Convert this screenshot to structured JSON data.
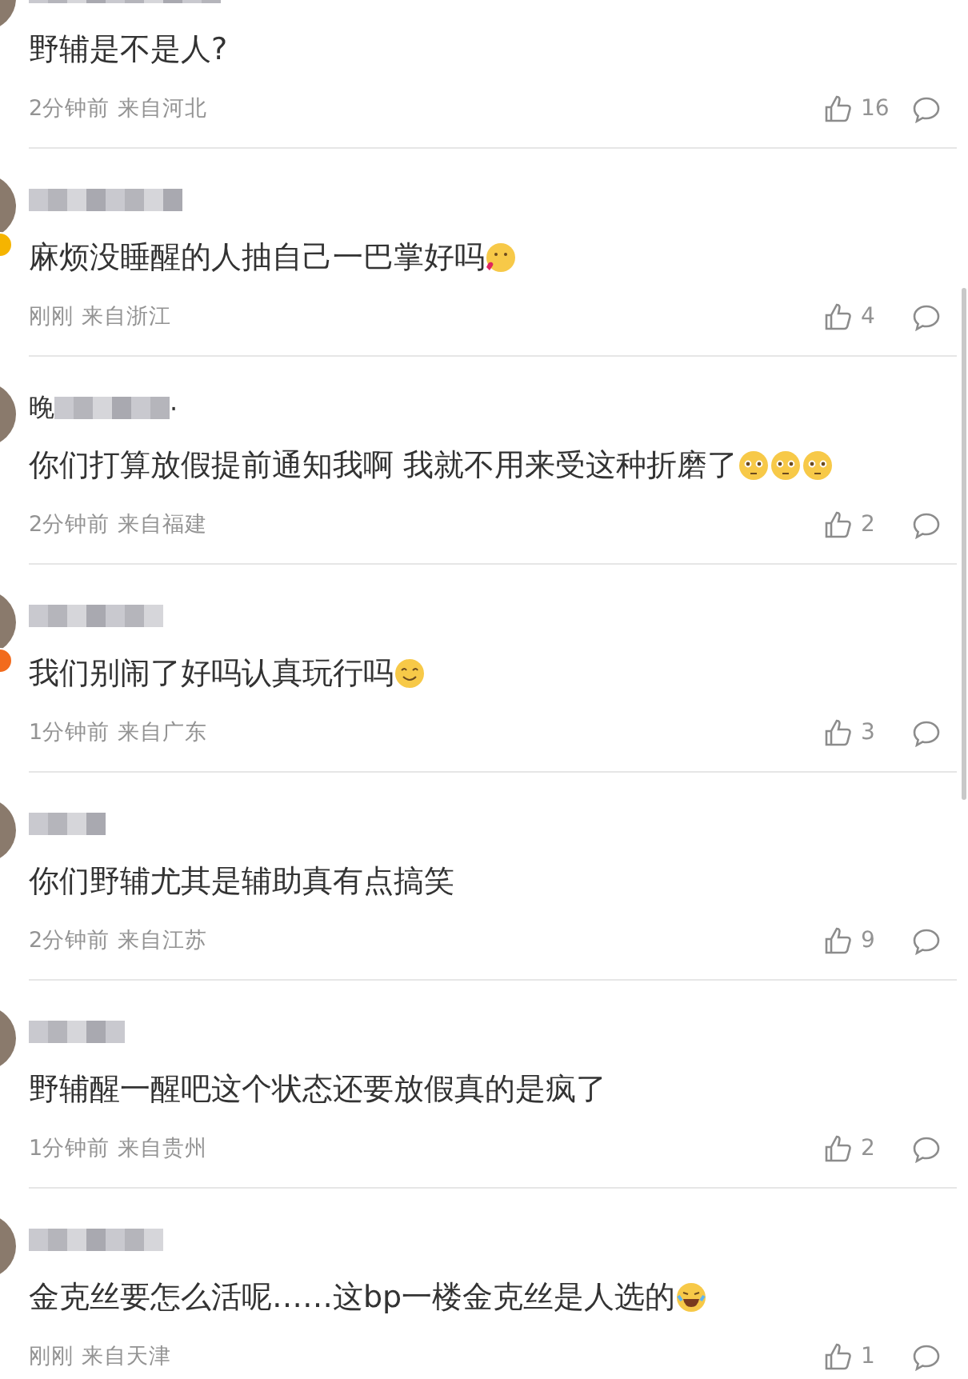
{
  "comments": [
    {
      "text": "野辅是不是人?",
      "time": "2分钟前",
      "location": "来自河北",
      "likes": "16"
    },
    {
      "text": "麻烦没睡醒的人抽自己一巴掌好吗",
      "emojis": [
        {
          "kind": "heart"
        }
      ],
      "time": "刚刚",
      "location": "来自浙江",
      "likes": "4",
      "badge": {
        "color": "#f5b400"
      }
    },
    {
      "name_prefix": "晚",
      "name_suffix": "·",
      "text": "你们打算放假提前通知我啊 我就不用来受这种折磨了",
      "emojis": [
        {
          "kind": "plead"
        },
        {
          "kind": "plead"
        },
        {
          "kind": "plead"
        }
      ],
      "time": "2分钟前",
      "location": "来自福建",
      "likes": "2"
    },
    {
      "text": "我们别闹了好吗认真玩行吗",
      "emojis": [
        {
          "kind": "smile"
        }
      ],
      "time": "1分钟前",
      "location": "来自广东",
      "likes": "3",
      "badge": {
        "color": "#f26b1d"
      }
    },
    {
      "text": "你们野辅尤其是辅助真有点搞笑",
      "time": "2分钟前",
      "location": "来自江苏",
      "likes": "9"
    },
    {
      "text": "野辅醒一醒吧这个状态还要放假真的是疯了",
      "time": "1分钟前",
      "location": "来自贵州",
      "likes": "2"
    },
    {
      "text": "金克丝要怎么活呢……这bp一楼金克丝是人选的",
      "emojis": [
        {
          "kind": "laugh"
        }
      ],
      "time": "刚刚",
      "location": "来自天津",
      "likes": "1"
    }
  ]
}
